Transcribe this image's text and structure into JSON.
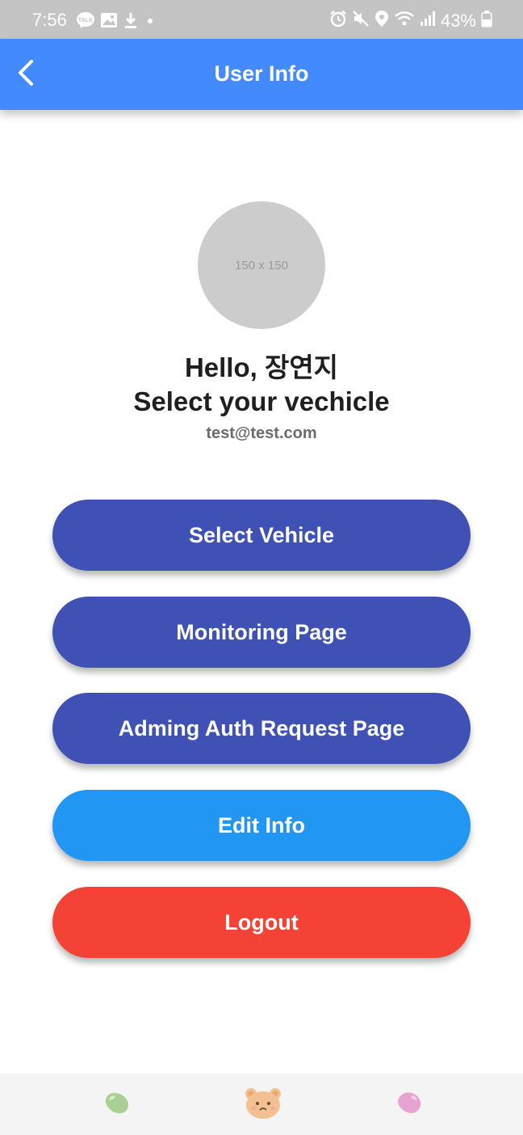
{
  "status_bar": {
    "time": "7:56",
    "battery": "43%",
    "left_icons": [
      "kakaotalk-icon",
      "gallery-icon",
      "download-icon",
      "dot-icon"
    ],
    "right_icons": [
      "alarm-icon",
      "mute-icon",
      "location-icon",
      "wifi-icon",
      "signal-icon",
      "battery-icon"
    ]
  },
  "app_bar": {
    "title": "User Info",
    "color": "#448aff"
  },
  "profile": {
    "avatar_placeholder": "150 x 150",
    "greeting": "Hello, 장연지",
    "subtitle": "Select your vechicle",
    "email": "test@test.com"
  },
  "buttons": [
    {
      "label": "Select Vehicle",
      "color": "#3f51b5"
    },
    {
      "label": "Monitoring Page",
      "color": "#3f51b5"
    },
    {
      "label": "Adming Auth Request Page",
      "color": "#3f51b5"
    },
    {
      "label": "Edit Info",
      "color": "#2196f3"
    },
    {
      "label": "Logout",
      "color": "#f44336"
    }
  ],
  "bottom_nav": {
    "items": [
      "green-jellybean-icon",
      "bear-face-icon",
      "pink-jellybean-icon"
    ]
  }
}
